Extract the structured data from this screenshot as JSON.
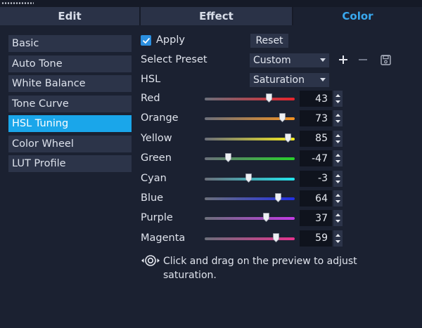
{
  "tabs": [
    {
      "label": "Edit",
      "active": false
    },
    {
      "label": "Effect",
      "active": false
    },
    {
      "label": "Color",
      "active": true
    }
  ],
  "nav": [
    {
      "label": "Basic",
      "active": false
    },
    {
      "label": "Auto Tone",
      "active": false
    },
    {
      "label": "White Balance",
      "active": false
    },
    {
      "label": "Tone Curve",
      "active": false
    },
    {
      "label": "HSL Tuning",
      "active": true
    },
    {
      "label": "Color Wheel",
      "active": false
    },
    {
      "label": "LUT Profile",
      "active": false
    }
  ],
  "panel": {
    "apply_label": "Apply",
    "apply_checked": true,
    "reset_label": "Reset",
    "preset_label": "Select Preset",
    "preset_value": "Custom",
    "hsl_label": "HSL",
    "hsl_value": "Saturation"
  },
  "sliders": [
    {
      "name": "Red",
      "value": "43",
      "level": 43,
      "gradient": [
        "#6b6f7a",
        "#e8242c"
      ]
    },
    {
      "name": "Orange",
      "value": "73",
      "level": 73,
      "gradient": [
        "#6b6f7a",
        "#f39222"
      ]
    },
    {
      "name": "Yellow",
      "value": "85",
      "level": 85,
      "gradient": [
        "#6b6f7a",
        "#f5ec1f"
      ]
    },
    {
      "name": "Green",
      "value": "-47",
      "level": -47,
      "gradient": [
        "#6b6f7a",
        "#27d12a"
      ]
    },
    {
      "name": "Cyan",
      "value": "-3",
      "level": -3,
      "gradient": [
        "#6b6f7a",
        "#22e6ee"
      ]
    },
    {
      "name": "Blue",
      "value": "64",
      "level": 64,
      "gradient": [
        "#6b6f7a",
        "#2230e6"
      ]
    },
    {
      "name": "Purple",
      "value": "37",
      "level": 37,
      "gradient": [
        "#6b6f7a",
        "#c23ae6"
      ]
    },
    {
      "name": "Magenta",
      "value": "59",
      "level": 59,
      "gradient": [
        "#6b6f7a",
        "#e6338f"
      ]
    }
  ],
  "hint": {
    "text": "Click and drag on the preview to adjust saturation."
  },
  "icons": {
    "add": "plus-icon",
    "remove": "minus-icon",
    "save": "save-icon",
    "target": "target-adjust-icon"
  },
  "colors": {
    "accent": "#1aa6ea",
    "tab_active_text": "#39a8ee"
  }
}
